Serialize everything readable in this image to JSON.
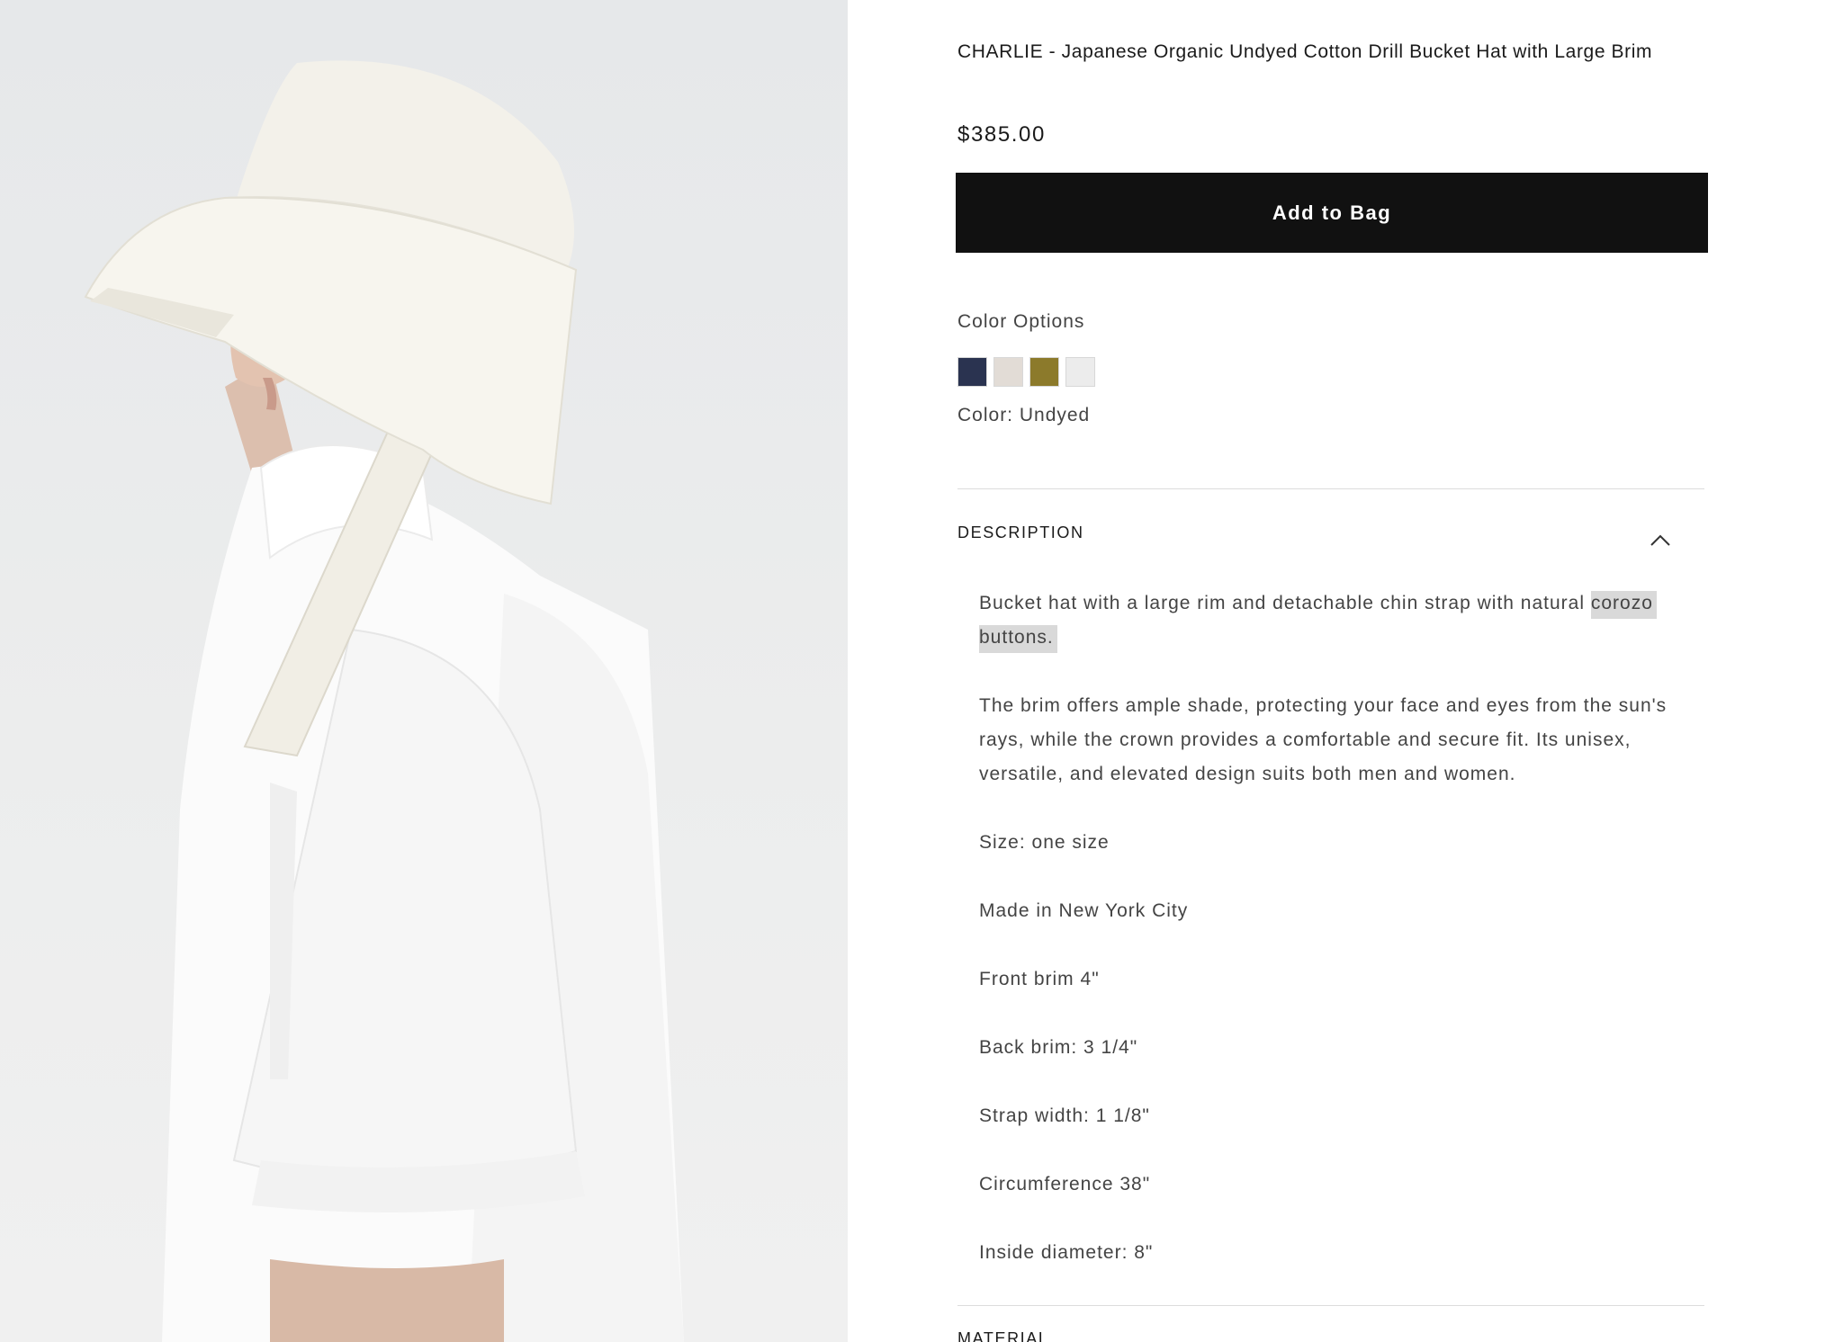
{
  "product": {
    "title": "CHARLIE - Japanese Organic Undyed Cotton Drill Bucket Hat with Large Brim",
    "price": "$385.00",
    "add_to_bag_label": "Add to Bag"
  },
  "colors": {
    "options_label": "Color Options",
    "current_label": "Color: Undyed",
    "swatches": [
      {
        "name": "navy",
        "color": "#2a3350"
      },
      {
        "name": "oatmeal",
        "color": "#e2dcd6"
      },
      {
        "name": "olive",
        "color": "#8c7a2b"
      },
      {
        "name": "undyed",
        "color": "#ececec"
      }
    ]
  },
  "description": {
    "heading": "DESCRIPTION",
    "para1_before": "Bucket hat with a large rim and detachable chin strap with natural ",
    "para1_highlight1": "corozo",
    "para1_highlight2": "buttons.",
    "para2": "The brim offers ample shade, protecting your face and eyes from the sun's rays, while the crown provides a comfortable and secure fit. Its unisex, versatile, and elevated design suits both men and women.",
    "size": "Size: one size",
    "origin": "Made in New York City",
    "front_brim": "Front brim 4\"",
    "back_brim": "Back brim: 3 1/4\"",
    "strap_width": "Strap width: 1 1/8\"",
    "circumference": "Circumference 38\"",
    "inside_diameter": "Inside diameter: 8\""
  },
  "material": {
    "heading": "MATERIAL"
  },
  "icons": {
    "chevron": "chevron-up-icon"
  }
}
